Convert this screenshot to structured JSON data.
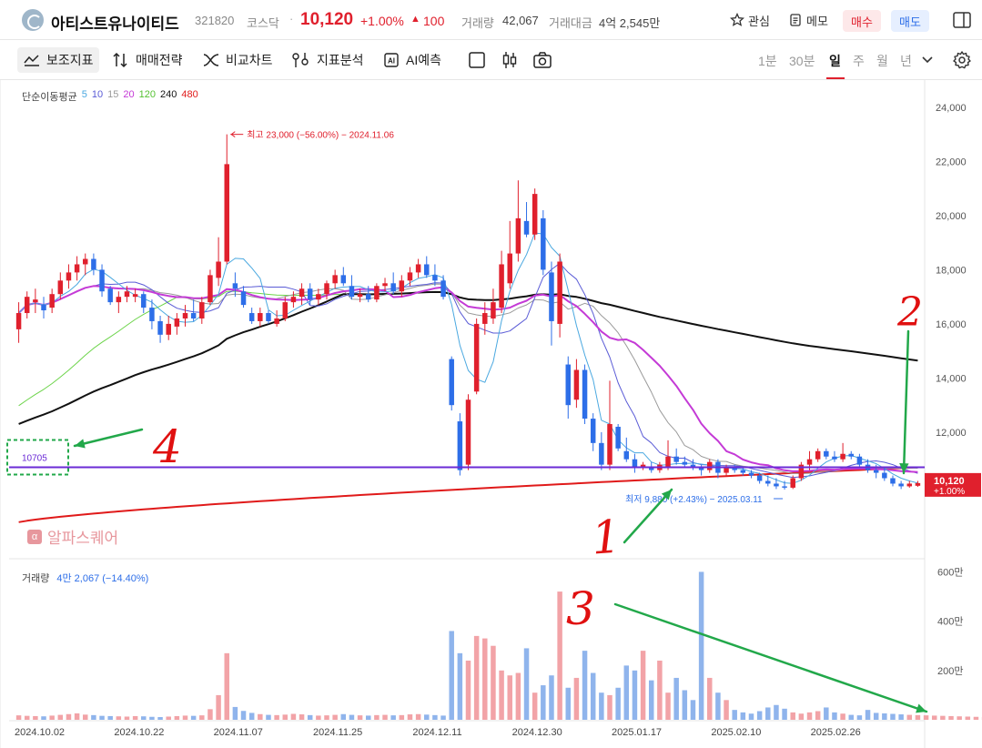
{
  "header": {
    "stock_name": "아티스트유나이티드",
    "stock_code": "321820",
    "market": "코스닥",
    "separator": "·",
    "price": "10,120",
    "change_pct": "+1.00%",
    "change_arrow": "▲",
    "change_abs": "100",
    "volume_label": "거래량",
    "volume_value": "42,067",
    "amount_label": "거래대금",
    "amount_value": "4억 2,545만",
    "favorite_label": "관심",
    "memo_label": "메모",
    "buy_label": "매수",
    "sell_label": "매도",
    "icons": [
      "star-icon",
      "memo-icon",
      "layout-icon"
    ]
  },
  "toolbar": {
    "indicators_label": "보조지표",
    "strategy_label": "매매전략",
    "compare_label": "비교차트",
    "analysis_label": "지표분석",
    "ai_label": "AI예측",
    "periods": [
      "1분",
      "30분",
      "일",
      "주",
      "월",
      "년"
    ],
    "selected_period": "일",
    "icons": [
      "indicator-icon",
      "strategy-icon",
      "compare-icon",
      "analysis-icon",
      "ai-icon",
      "square-icon",
      "candle-icon",
      "camera-icon",
      "chevron-down-icon",
      "gear-icon"
    ]
  },
  "ma_legend": {
    "label": "단순이동평균",
    "periods": [
      "5",
      "10",
      "15",
      "20",
      "120",
      "240",
      "480"
    ]
  },
  "volume_legend": {
    "label": "거래량",
    "value": "4만 2,067 (−14.40%)"
  },
  "watermark": {
    "mark": "α",
    "text": "알파스퀘어"
  },
  "colors": {
    "up": "#e0202d",
    "down": "#2d6ee8",
    "vol_up": "#f2a3a7",
    "vol_down": "#8fb4ec",
    "ma5": "#4aa8e0",
    "ma10": "#5a5bd6",
    "ma15": "#9a9a9a",
    "ma20": "#c43ad6",
    "ma120": "#6cd44a",
    "ma240": "#111111",
    "ma480": "#e01a1a",
    "level_line": "#6b2bd6",
    "annotation_red": "#e01010",
    "annotation_green": "#22a84a"
  },
  "chart_data": {
    "type": "candlestick",
    "x_labels": [
      "2024.10.02",
      "2024.10.22",
      "2024.11.07",
      "2024.11.25",
      "2024.12.11",
      "2024.12.30",
      "2025.01.17",
      "2025.02.10",
      "2025.02.26"
    ],
    "price_ticks": [
      "24,000",
      "22,000",
      "20,000",
      "18,000",
      "16,000",
      "14,000",
      "12,000"
    ],
    "price_range": [
      8200,
      24400
    ],
    "volume_ticks": [
      "600만",
      "400만",
      "200만"
    ],
    "volume_range": [
      0,
      6200000
    ],
    "max_annotation": "최고 23,000 (−56.00%) − 2024.11.06",
    "min_annotation": "최저 9,880 (+2.43%) − 2025.03.11",
    "current_price_label": "10,120",
    "current_change_label": "+1.00%",
    "level_label": "10705",
    "level_value": 10705,
    "candles": [
      {
        "o": 15800,
        "h": 16800,
        "l": 15300,
        "c": 16400
      },
      {
        "o": 16400,
        "h": 17200,
        "l": 16200,
        "c": 17000
      },
      {
        "o": 16800,
        "h": 17300,
        "l": 16400,
        "c": 16900
      },
      {
        "o": 16700,
        "h": 17000,
        "l": 16200,
        "c": 16500
      },
      {
        "o": 16600,
        "h": 17300,
        "l": 16400,
        "c": 17100
      },
      {
        "o": 17100,
        "h": 17900,
        "l": 16900,
        "c": 17600
      },
      {
        "o": 17600,
        "h": 18200,
        "l": 17300,
        "c": 17900
      },
      {
        "o": 17900,
        "h": 18500,
        "l": 17600,
        "c": 18200
      },
      {
        "o": 18200,
        "h": 18600,
        "l": 17800,
        "c": 18400
      },
      {
        "o": 18400,
        "h": 18600,
        "l": 17800,
        "c": 18000
      },
      {
        "o": 18000,
        "h": 18200,
        "l": 17000,
        "c": 17200
      },
      {
        "o": 17300,
        "h": 17400,
        "l": 16700,
        "c": 16800
      },
      {
        "o": 16800,
        "h": 17200,
        "l": 16400,
        "c": 17000
      },
      {
        "o": 17000,
        "h": 17400,
        "l": 16800,
        "c": 17200
      },
      {
        "o": 17000,
        "h": 17300,
        "l": 16800,
        "c": 17100
      },
      {
        "o": 17100,
        "h": 17200,
        "l": 16400,
        "c": 16600
      },
      {
        "o": 16600,
        "h": 16900,
        "l": 15800,
        "c": 16100
      },
      {
        "o": 16100,
        "h": 16300,
        "l": 15300,
        "c": 15600
      },
      {
        "o": 15600,
        "h": 16300,
        "l": 15400,
        "c": 16000
      },
      {
        "o": 15900,
        "h": 16400,
        "l": 15600,
        "c": 16200
      },
      {
        "o": 16200,
        "h": 16700,
        "l": 15900,
        "c": 16400
      },
      {
        "o": 16400,
        "h": 16900,
        "l": 16100,
        "c": 16200
      },
      {
        "o": 16200,
        "h": 17000,
        "l": 16000,
        "c": 16800
      },
      {
        "o": 16800,
        "h": 18000,
        "l": 16700,
        "c": 17800
      },
      {
        "o": 17700,
        "h": 19200,
        "l": 17400,
        "c": 18300
      },
      {
        "o": 18300,
        "h": 23000,
        "l": 18200,
        "c": 21900
      },
      {
        "o": 17500,
        "h": 17900,
        "l": 17000,
        "c": 17300
      },
      {
        "o": 17200,
        "h": 17400,
        "l": 16600,
        "c": 16700
      },
      {
        "o": 16400,
        "h": 16600,
        "l": 16000,
        "c": 16100
      },
      {
        "o": 16100,
        "h": 16600,
        "l": 15900,
        "c": 16400
      },
      {
        "o": 16400,
        "h": 16500,
        "l": 16000,
        "c": 16100
      },
      {
        "o": 16000,
        "h": 16500,
        "l": 15900,
        "c": 16200
      },
      {
        "o": 16200,
        "h": 17000,
        "l": 16100,
        "c": 16800
      },
      {
        "o": 16800,
        "h": 17200,
        "l": 16600,
        "c": 17000
      },
      {
        "o": 17000,
        "h": 17500,
        "l": 16700,
        "c": 17300
      },
      {
        "o": 17300,
        "h": 17500,
        "l": 16700,
        "c": 16900
      },
      {
        "o": 16900,
        "h": 17300,
        "l": 16700,
        "c": 17100
      },
      {
        "o": 17100,
        "h": 17600,
        "l": 16900,
        "c": 17500
      },
      {
        "o": 17500,
        "h": 18000,
        "l": 17300,
        "c": 17800
      },
      {
        "o": 17800,
        "h": 18100,
        "l": 17400,
        "c": 17500
      },
      {
        "o": 17400,
        "h": 17800,
        "l": 16900,
        "c": 17000
      },
      {
        "o": 17000,
        "h": 17300,
        "l": 16800,
        "c": 17100
      },
      {
        "o": 17100,
        "h": 17400,
        "l": 16800,
        "c": 16900
      },
      {
        "o": 16900,
        "h": 17500,
        "l": 16800,
        "c": 17400
      },
      {
        "o": 17400,
        "h": 17700,
        "l": 17200,
        "c": 17500
      },
      {
        "o": 17500,
        "h": 17900,
        "l": 17100,
        "c": 17200
      },
      {
        "o": 17200,
        "h": 17800,
        "l": 17000,
        "c": 17600
      },
      {
        "o": 17600,
        "h": 18100,
        "l": 17400,
        "c": 17900
      },
      {
        "o": 17900,
        "h": 18400,
        "l": 17700,
        "c": 18200
      },
      {
        "o": 18200,
        "h": 18500,
        "l": 17700,
        "c": 17800
      },
      {
        "o": 17800,
        "h": 18200,
        "l": 17400,
        "c": 17600
      },
      {
        "o": 17600,
        "h": 17800,
        "l": 16900,
        "c": 17000
      },
      {
        "o": 14700,
        "h": 14800,
        "l": 12800,
        "c": 13000
      },
      {
        "o": 12400,
        "h": 12700,
        "l": 10400,
        "c": 10600
      },
      {
        "o": 10800,
        "h": 13400,
        "l": 10600,
        "c": 13200
      },
      {
        "o": 13500,
        "h": 16200,
        "l": 13400,
        "c": 16000
      },
      {
        "o": 16000,
        "h": 16800,
        "l": 15600,
        "c": 16400
      },
      {
        "o": 16200,
        "h": 17300,
        "l": 16000,
        "c": 16800
      },
      {
        "o": 16600,
        "h": 18700,
        "l": 16400,
        "c": 18200
      },
      {
        "o": 17500,
        "h": 19800,
        "l": 17300,
        "c": 18600
      },
      {
        "o": 18600,
        "h": 21300,
        "l": 18300,
        "c": 19900
      },
      {
        "o": 19800,
        "h": 20500,
        "l": 19200,
        "c": 19300
      },
      {
        "o": 19300,
        "h": 21000,
        "l": 19100,
        "c": 20800
      },
      {
        "o": 19900,
        "h": 20200,
        "l": 17800,
        "c": 18000
      },
      {
        "o": 17900,
        "h": 18300,
        "l": 15200,
        "c": 16100
      },
      {
        "o": 16000,
        "h": 18600,
        "l": 15500,
        "c": 18300
      },
      {
        "o": 14500,
        "h": 14800,
        "l": 12500,
        "c": 13000
      },
      {
        "o": 13200,
        "h": 14700,
        "l": 12900,
        "c": 14300
      },
      {
        "o": 14300,
        "h": 14500,
        "l": 12300,
        "c": 12500
      },
      {
        "o": 12500,
        "h": 12700,
        "l": 11300,
        "c": 11600
      },
      {
        "o": 11600,
        "h": 12000,
        "l": 10600,
        "c": 10800
      },
      {
        "o": 10800,
        "h": 13900,
        "l": 10600,
        "c": 12300
      },
      {
        "o": 12200,
        "h": 12300,
        "l": 11300,
        "c": 11400
      },
      {
        "o": 11300,
        "h": 11800,
        "l": 10900,
        "c": 11000
      },
      {
        "o": 11000,
        "h": 11200,
        "l": 10500,
        "c": 10700
      },
      {
        "o": 10700,
        "h": 10900,
        "l": 10600,
        "c": 10800
      },
      {
        "o": 10700,
        "h": 10900,
        "l": 10500,
        "c": 10600
      },
      {
        "o": 10600,
        "h": 10900,
        "l": 10500,
        "c": 10800
      },
      {
        "o": 10700,
        "h": 11700,
        "l": 10600,
        "c": 11100
      },
      {
        "o": 11100,
        "h": 11400,
        "l": 10800,
        "c": 10900
      },
      {
        "o": 10900,
        "h": 11100,
        "l": 10700,
        "c": 10800
      },
      {
        "o": 10800,
        "h": 11000,
        "l": 10600,
        "c": 10700
      },
      {
        "o": 10700,
        "h": 10800,
        "l": 10400,
        "c": 10600
      },
      {
        "o": 10600,
        "h": 11000,
        "l": 10500,
        "c": 10900
      },
      {
        "o": 10900,
        "h": 11000,
        "l": 10300,
        "c": 10500
      },
      {
        "o": 10500,
        "h": 10800,
        "l": 10400,
        "c": 10700
      },
      {
        "o": 10700,
        "h": 10800,
        "l": 10500,
        "c": 10600
      },
      {
        "o": 10600,
        "h": 10700,
        "l": 10400,
        "c": 10500
      },
      {
        "o": 10500,
        "h": 10600,
        "l": 10300,
        "c": 10400
      },
      {
        "o": 10400,
        "h": 10500,
        "l": 10100,
        "c": 10200
      },
      {
        "o": 10200,
        "h": 10400,
        "l": 10000,
        "c": 10100
      },
      {
        "o": 10100,
        "h": 10300,
        "l": 9900,
        "c": 10000
      },
      {
        "o": 10000,
        "h": 10200,
        "l": 9880,
        "c": 9950
      },
      {
        "o": 9950,
        "h": 10400,
        "l": 9900,
        "c": 10300
      },
      {
        "o": 10300,
        "h": 10900,
        "l": 10200,
        "c": 10800
      },
      {
        "o": 10800,
        "h": 11300,
        "l": 10600,
        "c": 11000
      },
      {
        "o": 11000,
        "h": 11400,
        "l": 10900,
        "c": 11300
      },
      {
        "o": 11300,
        "h": 11400,
        "l": 11000,
        "c": 11100
      },
      {
        "o": 11100,
        "h": 11300,
        "l": 10900,
        "c": 11000
      },
      {
        "o": 11000,
        "h": 11600,
        "l": 10900,
        "c": 11200
      },
      {
        "o": 11200,
        "h": 11300,
        "l": 11000,
        "c": 11100
      },
      {
        "o": 11100,
        "h": 11200,
        "l": 10700,
        "c": 10800
      },
      {
        "o": 10800,
        "h": 11000,
        "l": 10500,
        "c": 10600
      },
      {
        "o": 10600,
        "h": 10800,
        "l": 10300,
        "c": 10500
      },
      {
        "o": 10500,
        "h": 10700,
        "l": 10200,
        "c": 10300
      },
      {
        "o": 10300,
        "h": 10400,
        "l": 10000,
        "c": 10100
      },
      {
        "o": 10100,
        "h": 10200,
        "l": 9900,
        "c": 10000
      },
      {
        "o": 10000,
        "h": 10200,
        "l": 9950,
        "c": 10100
      },
      {
        "o": 10020,
        "h": 10200,
        "l": 9980,
        "c": 10120
      }
    ],
    "volumes": [
      180000,
      160000,
      150000,
      140000,
      170000,
      200000,
      230000,
      260000,
      210000,
      190000,
      160000,
      150000,
      140000,
      130000,
      150000,
      140000,
      120000,
      110000,
      130000,
      150000,
      170000,
      160000,
      180000,
      430000,
      1000000,
      2700000,
      520000,
      360000,
      280000,
      230000,
      200000,
      190000,
      210000,
      240000,
      220000,
      190000,
      170000,
      180000,
      200000,
      230000,
      200000,
      180000,
      170000,
      190000,
      200000,
      180000,
      190000,
      220000,
      230000,
      210000,
      190000,
      170000,
      3600000,
      2700000,
      2400000,
      3400000,
      3300000,
      3000000,
      2000000,
      1800000,
      1900000,
      2900000,
      1100000,
      1400000,
      1800000,
      5200000,
      1300000,
      1700000,
      2800000,
      1900000,
      1100000,
      1000000,
      1300000,
      2200000,
      2000000,
      2800000,
      1600000,
      2400000,
      1100000,
      1700000,
      1200000,
      800000,
      6000000,
      1700000,
      1100000,
      800000,
      400000,
      300000,
      250000,
      350000,
      500000,
      600000,
      450000,
      300000,
      250000,
      300000,
      350000,
      500000,
      300000,
      250000,
      200000,
      180000,
      400000,
      280000,
      260000,
      240000,
      220000,
      200000,
      190000,
      180000,
      170000,
      160000,
      150000,
      140000,
      130000,
      120000,
      110000,
      100000,
      100000,
      90000,
      80000,
      80000,
      70000,
      60000,
      60000,
      50000,
      40000
    ]
  },
  "annotations": {
    "labels": [
      "1",
      "2",
      "3",
      "4"
    ]
  }
}
